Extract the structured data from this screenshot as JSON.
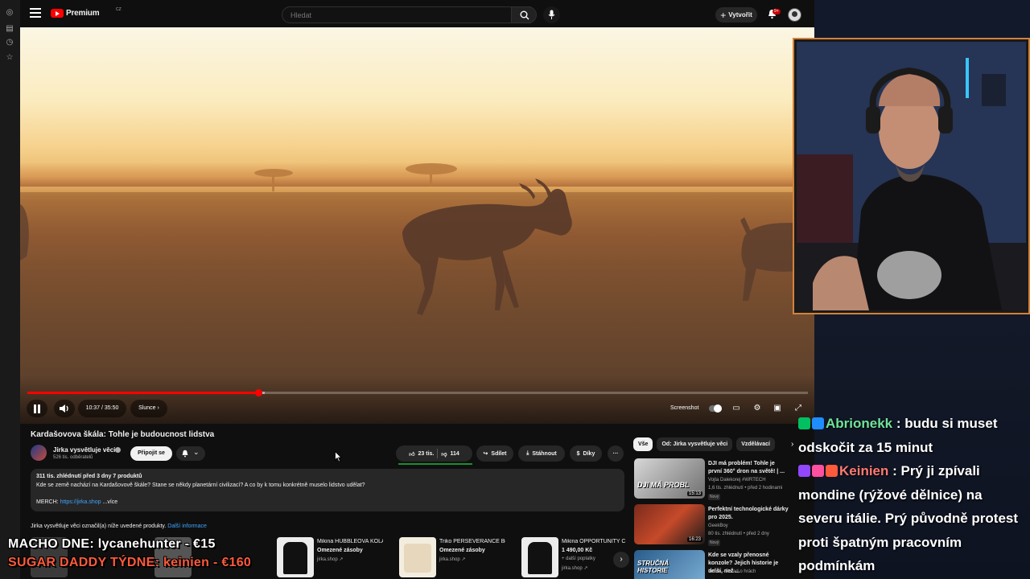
{
  "app": {
    "logo_text": "Premium",
    "region": "CZ"
  },
  "search": {
    "placeholder": "Hledat"
  },
  "header": {
    "create_label": "Vytvořit",
    "notification_count": "9+"
  },
  "player": {
    "time": "10:37 / 35:50",
    "chapter": "Slunce",
    "screenshot_label": "Screenshot",
    "progress_fraction": 0.296,
    "buffered_fraction": 0.304
  },
  "video": {
    "title": "Kardašovova škála: Tohle je budoucnost lidstva",
    "channel": "Jirka vysvětluje věci",
    "subscribers": "526 tis. odběratelů",
    "join_label": "Připojit se",
    "likes": "23 tis.",
    "dislikes": "114",
    "share_label": "Sdílet",
    "download_label": "Stáhnout",
    "thanks_label": "Díky"
  },
  "description": {
    "stats": "311 tis. zhlédnutí  před 3 dny  7 produktů",
    "text": "Kde se země nachází na Kardašovově škále? Stane se někdy planetární civilizací? A co by k tomu konkrétně muselo lidstvo udělat?",
    "merch_label": "MERCH:",
    "merch_link": "https://jirka.shop",
    "more": "...více"
  },
  "products_header": {
    "text": "Jirka vysvětluje věci označil(a) níže uvedené produkty.",
    "link": "Další informace"
  },
  "products": [
    {
      "title": "Mikina HUBBLEOVA KOLÁŽ...",
      "stock": "Omezené zásoby",
      "shop": "jirka.shop ↗"
    },
    {
      "title": "Triko PERSEVERANCE Béž...",
      "stock": "Omezené zásoby",
      "shop": "jirka.shop ↗"
    },
    {
      "title": "Mikina OPPORTUNITY Č",
      "price": "1 490,00 Kč",
      "extra": "+ další poplatky",
      "shop": "jirka.shop ↗"
    }
  ],
  "chips": [
    "Vše",
    "Od: Jirka vysvětluje věci",
    "Vzdělávací"
  ],
  "related": [
    {
      "title": "DJI má problém! Tohle je první 360° dron na světě! | ...",
      "channel": "Vojta Dalekorej #WRTECH",
      "meta": "1,6 tis. zhlédnutí • před 2 hodinami",
      "badge": "Nový",
      "duration": "15:13",
      "thumb_text": "DJI MÁ PROBL"
    },
    {
      "title": "Perfektní technologické dárky pro 2025.",
      "channel": "GeekBoy",
      "meta": "80 tis. zhlédnutí • před 2 dny",
      "badge": "Nový",
      "duration": "16:23"
    },
    {
      "title": "Kde se vzaly přenosné konzole? Jejich historie je delší, než ...",
      "channel": "Indian - Pořad o hrách",
      "thumb_text": "STRUČNÁ HISTORIE"
    }
  ],
  "stream": {
    "chat": [
      {
        "user": "Abrionekk",
        "message": " : budu si muset odskočit za 15 minut"
      },
      {
        "user": "Keinien",
        "message": " : Prý ji zpívali mondine (rýžové dělnice) na severu itálie. Prý původně protest proti špatným pracovním podmínkám"
      }
    ],
    "ticker_line1": "MACHO DNE: lycanehunter - €15",
    "ticker_line2": "SUGAR DADDY TÝDNE: keinien - €160"
  },
  "colors": {
    "accent": "#ff0000",
    "link": "#3ea6ff",
    "chat_user1": "#6fe39a",
    "chat_user2": "#ff7a72",
    "webcam_border": "#d4823a"
  }
}
